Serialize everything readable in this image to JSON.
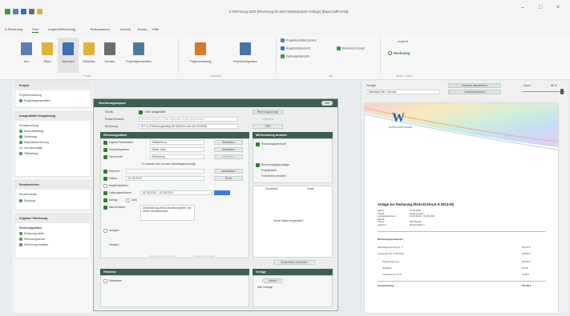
{
  "window": {
    "title": "E-Rechnung 2025 (Rechnung für SEO Musterprojekt Vorlage) [Bauschaffenrest]",
    "controls": {
      "minimize": "–",
      "maximize": "□",
      "close": "×"
    }
  },
  "menu": {
    "items": [
      "E-Rechnung",
      "Start",
      "Angebot/Rechnung",
      "Textbausteine",
      "Ansicht",
      "Extras",
      "Hilfe"
    ],
    "active_index": 1
  },
  "ribbon": {
    "buttons": [
      {
        "label": "Neu",
        "icon": "new-document-icon",
        "color": "#5b7fb0"
      },
      {
        "label": "Öffnen",
        "icon": "open-folder-icon",
        "color": "#e2b13c"
      },
      {
        "label": "Speichern",
        "icon": "save-disk-icon",
        "color": "#3b6fb6"
      },
      {
        "label": "Schließen",
        "icon": "close-folder-icon",
        "color": "#e2b13c"
      },
      {
        "label": "Drucken",
        "icon": "printer-icon",
        "color": "#6d6d6d"
      },
      {
        "label": "Projekteigenschaften",
        "icon": "project-properties-icon",
        "color": "#4a7d9d"
      },
      {
        "label": "Projektverwaltung",
        "icon": "project-manager-icon",
        "color": "#d9772b"
      },
      {
        "label": "Projektkonfiguration",
        "icon": "project-config-icon",
        "color": "#4673a8"
      }
    ],
    "group_labels": [
      "Projekt",
      "Verwalten",
      "Info"
    ],
    "small_items": [
      "Projektkonsistenzcheck",
      "Angebotsübersicht",
      "Zahlungsübersicht",
      "Business-Cockpit"
    ],
    "offer_group": {
      "title": "Angebot",
      "action": "Rechnung",
      "footer": "Ablauf / Status"
    }
  },
  "sidebar": {
    "cards": [
      {
        "title": "Projekt",
        "items": [
          "Projektverwaltung",
          "Projekteigenschaften"
        ]
      },
      {
        "title": "Ausgewählte Gruppierung",
        "items": [
          "Zusatzbuchung",
          "Pauschalbetrag",
          "Zeitbetrag",
          "Materialberechnung",
          "Zu- und Abschläge",
          "Teilleistung"
        ]
      },
      {
        "title": "Rendierstellen",
        "items": [
          "Rendierstellen",
          "Rundung"
        ]
      },
      {
        "title": "Angebot / Rechnung",
        "items": [
          "Rechnungsdaten",
          "Erfassung laden",
          "Rechnungsdruck",
          "Rechnung erstellen"
        ]
      }
    ]
  },
  "dialog": {
    "title": "Rechnungsexport",
    "help": "Hilfe",
    "top_rows": [
      {
        "label": "Schritt:",
        "value": "nicht ausgewählt"
      },
      {
        "label": "E-Mail-Versand:",
        "value": "Rechnung wird in einer separaten Datei gespeichert"
      },
      {
        "label": "Rechnung:",
        "value": "SO 11 (Rechnungsbeleg für 04/2024 oder ab 01/2025)"
      }
    ],
    "top_buttons": [
      "Rechnungsvorlage",
      "Optionen",
      "Hilfe"
    ],
    "section_left": "Rechnungsdaten",
    "fields": [
      {
        "label": "Eigene Firmendaten",
        "value": "Musterfirma",
        "btn": "Bearbeiten"
      },
      {
        "label": "Ansprechpartner",
        "value": "Meier, Max",
        "btn": "Bearbeiten"
      },
      {
        "label": "Überschrift:",
        "value": "Rechnung",
        "btn": "Bearbeiten"
      }
    ],
    "text_note": "Es handelt sich um eine Abschlagsrechnung",
    "more_rows": [
      {
        "label": "Nummer:",
        "value": "",
        "btn": "Automatisch"
      },
      {
        "label": "Datum:",
        "value": "01.05.2024",
        "btn": "Heute"
      },
      {
        "label": "Angebotsdatum:",
        "value": ""
      },
      {
        "label": "Leistungszeitraum:",
        "value": "01.05.2024 – 31.05.2024"
      },
      {
        "label": "Betrag:",
        "value": "Auto"
      },
      {
        "label": "Bauvorhaben:",
        "value": "Durchführung eines Musterprojektes mit einem Musterkunden"
      },
      {
        "label": "Anlagen:",
        "value": ""
      },
      {
        "label": "Hinweis:",
        "value": ""
      }
    ],
    "bottom_buttons": [
      "Hinweistexte vorbereiten",
      "Vorlagen bearbeiten"
    ],
    "section_right": "Mit Rechnung drucken",
    "right_checks": [
      "Rechnungsübersicht",
      "Berechnungsgrundlage",
      "Projektname",
      "Fußzeichen drucken"
    ],
    "table_headers": [
      "Zusatzfeld",
      "Inhalt"
    ],
    "empty_text": "Keine Daten ausgewählt.",
    "table_button": "Zusatzfelder bearbeiten",
    "section_bottom_left": "Hinweise",
    "bottom_check": "Mahnstufe",
    "section_bottom_right": "Vorlage",
    "preview_button": "Ansicht",
    "status": "kein Vorlage"
  },
  "preview": {
    "toolbar_label": "Vorlage:",
    "toolbar_value": "Standard Tab 1 (Excel)",
    "buttons": [
      "Vorschau aktualisieren",
      "Vorschau drucken"
    ],
    "zoom_label": "Zoom:",
    "zoom_value": "86 %",
    "logo_text": "W",
    "company": "MUSTER BAUSCHAFFEN",
    "doc_title": "Anlage zur Rechnung (ROH ECHALE R 2024-00)",
    "meta_labels": [
      "Datum:",
      "Objekt:",
      "Leistungszeitraum:",
      "Betreff:",
      "Kunde:",
      "Adresse:"
    ],
    "meta_values": [
      "01.05.2024",
      "Musterprojekt",
      "01.05.2024 – 31.05.2024",
      "",
      "Max Muster",
      "Musterstraße 1"
    ],
    "section_label": "Rechnungspositionen",
    "rows": [
      {
        "label": "Abschlagsrechnung Nr. 1",
        "value": "100,00 €"
      },
      {
        "label": "Leistungen bis 31.05.2024",
        "value": "120,00 €"
      },
      {
        "label": "Zwischensumme",
        "value": "220,00 €"
      },
      {
        "label": "Nachlass",
        "value": "0,00 €"
      },
      {
        "label": "Umsatzsteuer 19 %",
        "value": "41,80 €"
      },
      {
        "label": "Gesamtbetrag",
        "value": "261,80 €"
      }
    ]
  }
}
